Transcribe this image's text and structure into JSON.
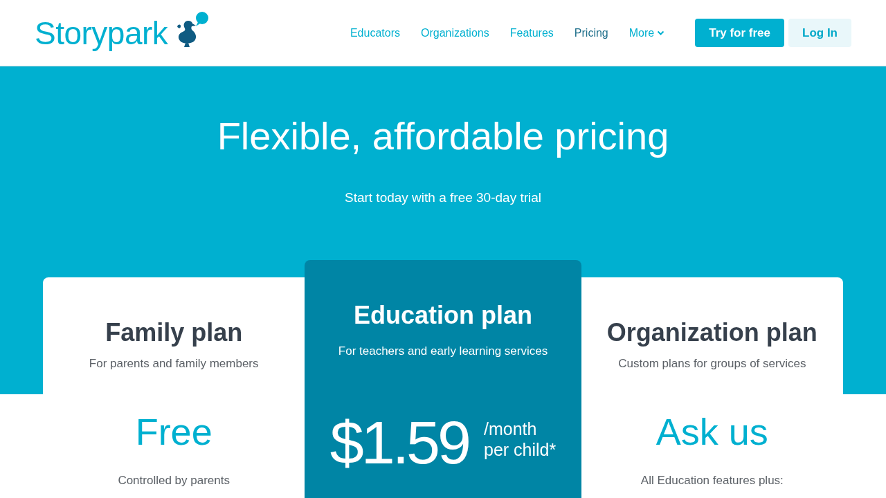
{
  "header": {
    "logo": "Storypark",
    "nav": [
      {
        "label": "Educators",
        "selected": false,
        "kind": "link"
      },
      {
        "label": "Organizations",
        "selected": false,
        "kind": "link"
      },
      {
        "label": "Features",
        "selected": false,
        "kind": "link"
      },
      {
        "label": "Pricing",
        "selected": true,
        "kind": "link"
      },
      {
        "label": "More",
        "selected": false,
        "kind": "dropdown"
      }
    ],
    "buttons": [
      {
        "label": "Try for free",
        "kind": "primary"
      },
      {
        "label": "Log In",
        "kind": "light"
      }
    ]
  },
  "hero": {
    "title": "Flexible, affordable pricing",
    "subtitle": "Start today with a free 30-day trial"
  },
  "plans": [
    {
      "title": "Family plan",
      "subtitle": "For parents and family members",
      "price": "Free",
      "note": "Controlled by parents",
      "featured": false
    },
    {
      "title": "Education plan",
      "subtitle": "For teachers and early learning services",
      "price": "$1.59",
      "price_unit": [
        "/month",
        "per child*"
      ],
      "featured": true
    },
    {
      "title": "Organization plan",
      "subtitle": "Custom plans for groups of services",
      "price": "Ask us",
      "note": "All Education features plus:",
      "featured": false
    }
  ]
}
